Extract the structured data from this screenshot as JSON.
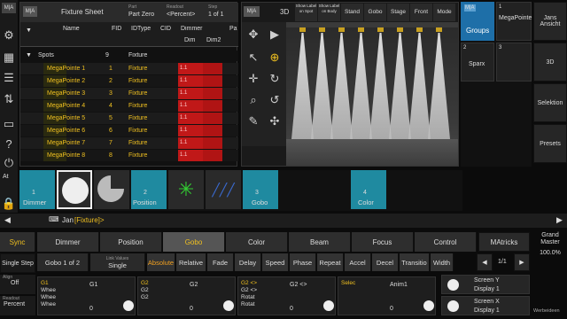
{
  "left_bar": {
    "at": "At"
  },
  "sheet": {
    "logo": "M|A",
    "title": "Fixture Sheet",
    "part_label": "Part",
    "part_value": "Part Zero",
    "readout_label": "Readout",
    "readout_value": "<Percent>",
    "step_label": "Step",
    "step_value": "1 of 1",
    "headers": [
      "Name",
      "FID",
      "IDType",
      "CID",
      "Dimmer",
      "Pa"
    ],
    "subheaders": [
      "Dim",
      "Dim2"
    ],
    "group_row": {
      "name": "Spots",
      "fid": "9",
      "type": "Fixture"
    },
    "rows": [
      {
        "name": "MegaPointe 1",
        "fid": "1",
        "type": "Fixture",
        "dim": "1.1"
      },
      {
        "name": "MegaPointe 2",
        "fid": "2",
        "type": "Fixture",
        "dim": "1.1"
      },
      {
        "name": "MegaPointe 3",
        "fid": "3",
        "type": "Fixture",
        "dim": "1.1"
      },
      {
        "name": "MegaPointe 4",
        "fid": "4",
        "type": "Fixture",
        "dim": "1.1"
      },
      {
        "name": "MegaPointe 5",
        "fid": "5",
        "type": "Fixture",
        "dim": "1.1"
      },
      {
        "name": "MegaPointe 6",
        "fid": "6",
        "type": "Fixture",
        "dim": "1.1"
      },
      {
        "name": "MegaPointe 7",
        "fid": "7",
        "type": "Fixture",
        "dim": "1.1"
      },
      {
        "name": "MegaPointe 8",
        "fid": "8",
        "type": "Fixture",
        "dim": "1.1"
      }
    ]
  },
  "viewer": {
    "logo": "M|A",
    "label": "3D",
    "buttons": [
      "Show Label on Spot",
      "Show Label on Body",
      "Stand",
      "Gobo",
      "Stage",
      "Front",
      "Mode"
    ],
    "sub": [
      "",
      "",
      "",
      "",
      "Stage",
      "",
      ""
    ]
  },
  "groups": {
    "logo": "M|A",
    "title": "Groups",
    "tiles": [
      {
        "num": "1",
        "label": "MegaPointe"
      },
      {
        "num": "2",
        "label": "Sparx"
      },
      {
        "num": "3",
        "label": ""
      }
    ]
  },
  "right_views": [
    "Jans Ansicht",
    "3D",
    "Selektion",
    "Presets"
  ],
  "presets": [
    {
      "num": "1",
      "label": "Dimmer"
    },
    {
      "num": "2",
      "label": "Position"
    },
    {
      "num": "3",
      "label": "Gobo"
    },
    {
      "num": "4",
      "label": "Color"
    }
  ],
  "cmdline": {
    "prefix": "Jan",
    "bracket": "[Fixture]>"
  },
  "sync": "Sync",
  "tabs": [
    "Dimmer",
    "Position",
    "Gobo",
    "Color",
    "Beam",
    "Focus",
    "Control"
  ],
  "matricks": "MAtricks",
  "grand": {
    "label": "Grand Master",
    "value": "100.0%"
  },
  "single_step": "Single Step",
  "gobo_count": "Gobo 1 of 2",
  "link_values": {
    "label": "Link Values",
    "value": "Single"
  },
  "attr_buttons": [
    "Absolute",
    "Relative",
    "Fade",
    "Delay",
    "Speed",
    "Phase",
    "Repeat",
    "Accel",
    "Decel",
    "Transitio",
    "Width"
  ],
  "page": "1/1",
  "align": {
    "label": "Align",
    "value": "Off"
  },
  "readout": {
    "label": "Readout",
    "value": "Percent"
  },
  "encoders": [
    {
      "tag": "G1",
      "lines": [
        "Whee",
        "Whee",
        "Whee"
      ],
      "name": "G1",
      "value": "0"
    },
    {
      "tag": "G2",
      "lines": [
        "G2",
        "G2"
      ],
      "name": "G2",
      "value": "0"
    },
    {
      "tag": "G2 <>",
      "lines": [
        "G2 <>",
        "Rotat",
        "Rotat"
      ],
      "name": "G2 <>",
      "value": "0"
    },
    {
      "tag": "Selec",
      "lines": [],
      "name": "Anim1",
      "value": "0"
    }
  ],
  "screens": [
    {
      "l1": "Screen Y",
      "l2": "Display 1"
    },
    {
      "l1": "Screen X",
      "l2": "Display 1"
    }
  ],
  "footer": "Werbeideen"
}
